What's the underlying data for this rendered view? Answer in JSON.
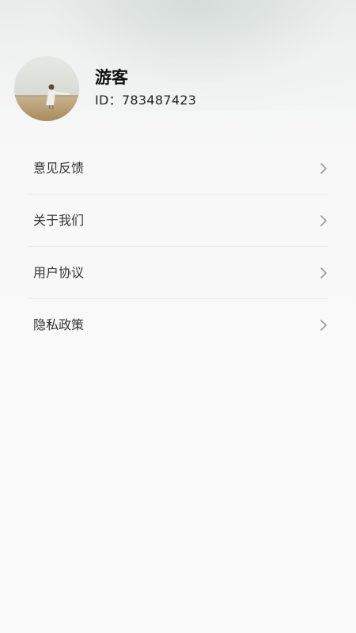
{
  "profile": {
    "name": "游客",
    "id_label": "ID：783487423"
  },
  "menu": {
    "items": [
      {
        "label": "意见反馈",
        "icon": "chevron-right-icon"
      },
      {
        "label": "关于我们",
        "icon": "chevron-right-icon"
      },
      {
        "label": "用户协议",
        "icon": "chevron-right-icon"
      },
      {
        "label": "隐私政策",
        "icon": "chevron-right-icon"
      }
    ]
  },
  "colors": {
    "text_primary": "#111111",
    "text_menu": "#333333",
    "chevron": "#9a9a9a",
    "divider": "#ececec",
    "background": "#fafafa"
  }
}
